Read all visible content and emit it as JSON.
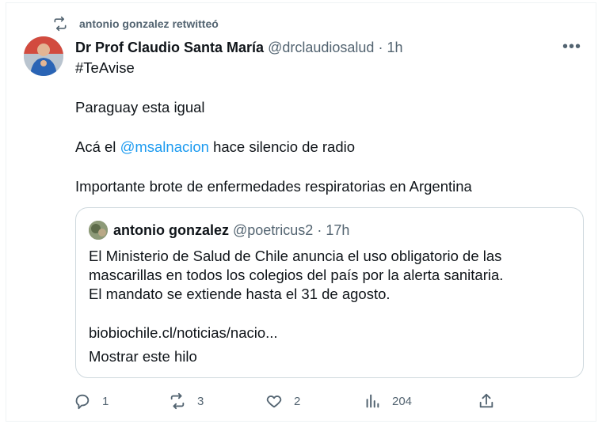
{
  "retweet": {
    "icon": "retweet-icon",
    "label": "antonio gonzalez retwitteó"
  },
  "tweet": {
    "avatar": "avatar",
    "author_name": "Dr Prof Claudio Santa María",
    "author_handle": "@drclaudiosalud",
    "separator": "·",
    "time": "1h",
    "more_label": "•••",
    "hashtag": "#TeAvise",
    "line1": "Paraguay esta igual",
    "line2_prefix": "Acá el",
    "line2_mention": "@msalnacion",
    "line2_suffix": "hace silencio de radio",
    "line3": "Importante brote de enfermedades respiratorias en Argentina"
  },
  "quote": {
    "author_name": "antonio gonzalez",
    "author_handle": "@poetricus2",
    "separator": "·",
    "time": "17h",
    "line1": "El Ministerio de Salud de Chile anuncia el uso obligatorio de las",
    "line2": "mascarillas en todos los colegios del país por la alerta sanitaria.",
    "line3": "El mandato se extiende hasta el 31 de agosto.",
    "link": "biobiochile.cl/noticias/nacio...",
    "show_thread": "Mostrar este hilo"
  },
  "actions": {
    "replies": "1",
    "retweets": "3",
    "likes": "2",
    "views": "204"
  },
  "colors": {
    "accent": "#1d9bf0",
    "muted": "#536471",
    "text": "#0f1419",
    "border": "#cfd9de"
  }
}
